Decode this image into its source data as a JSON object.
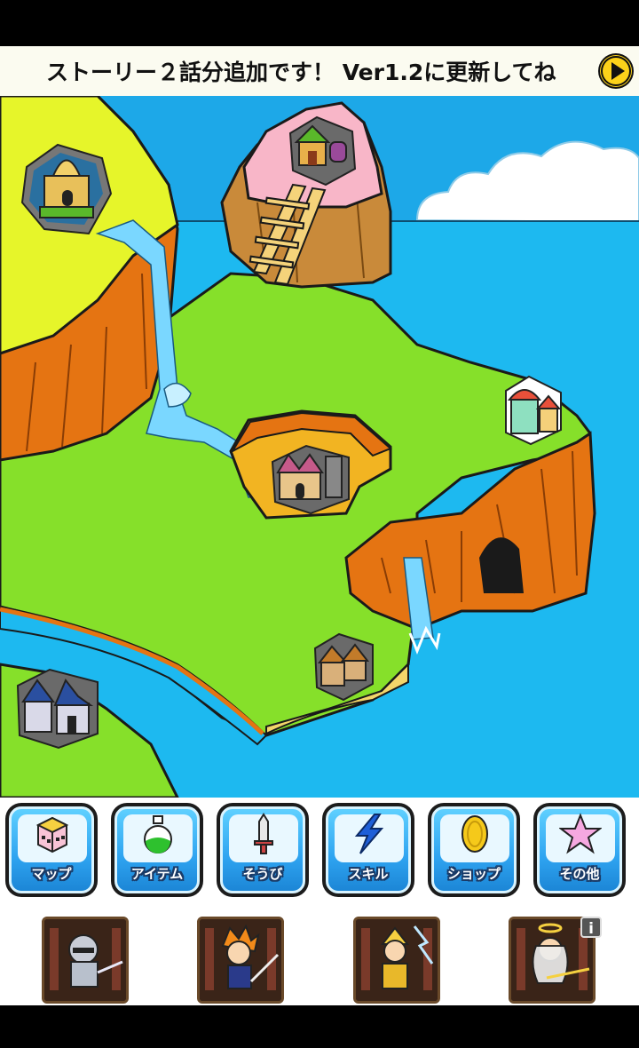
{
  "ticker": {
    "message": "ストーリー２話分追加です！ Ver1.2に更新してね",
    "play_icon": "play-triangle-icon"
  },
  "map": {
    "locations": [
      {
        "name": "castle",
        "icon": "castle-icon"
      },
      {
        "name": "cliff-house",
        "icon": "house-with-tower-icon"
      },
      {
        "name": "valley-town",
        "icon": "town-with-tower-icon"
      },
      {
        "name": "coastal-town",
        "icon": "colorful-town-icon"
      },
      {
        "name": "beach-village",
        "icon": "village-icon"
      },
      {
        "name": "blue-town",
        "icon": "blue-roof-town-icon"
      }
    ],
    "colors": {
      "sea": "#1db9f0",
      "grass": "#86e02a",
      "cliff": "#e57412",
      "plateau": "#e6f52a",
      "peak": "#f8b6c8"
    }
  },
  "menu": {
    "items": [
      {
        "label": "マップ",
        "icon": "map-cube-icon"
      },
      {
        "label": "アイテム",
        "icon": "potion-icon"
      },
      {
        "label": "そうび",
        "icon": "sword-icon"
      },
      {
        "label": "スキル",
        "icon": "lightning-icon"
      },
      {
        "label": "ショップ",
        "icon": "coin-icon"
      },
      {
        "label": "その他",
        "icon": "star-icon"
      }
    ]
  },
  "party": {
    "members": [
      {
        "icon": "silver-knight-portrait"
      },
      {
        "icon": "orange-hair-swordsman-portrait"
      },
      {
        "icon": "golden-armor-lancer-portrait"
      },
      {
        "icon": "winged-valkyrie-portrait"
      }
    ],
    "info_label": "i"
  }
}
